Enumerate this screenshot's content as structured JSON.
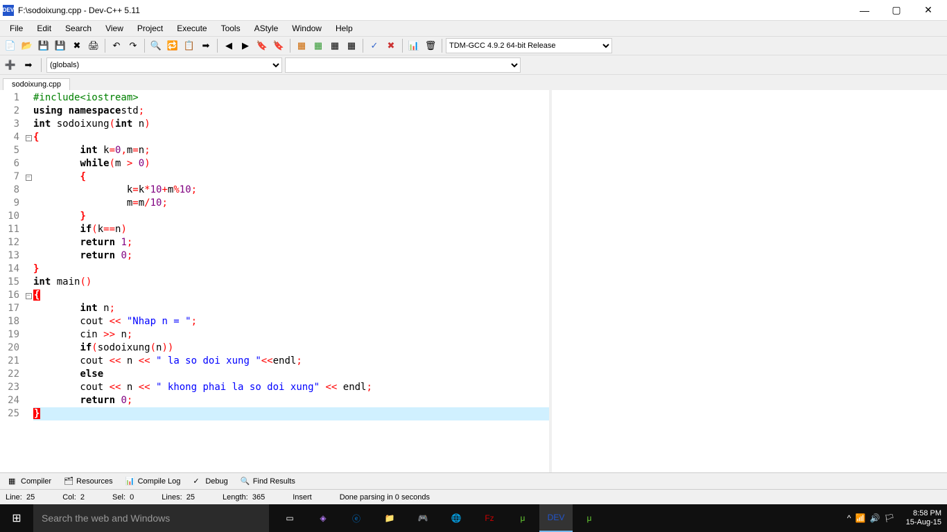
{
  "window": {
    "title": "F:\\sodoixung.cpp - Dev-C++ 5.11",
    "appicon": "DEV"
  },
  "menu": {
    "file": "File",
    "edit": "Edit",
    "search": "Search",
    "view": "View",
    "project": "Project",
    "execute": "Execute",
    "tools": "Tools",
    "astyle": "AStyle",
    "window": "Window",
    "help": "Help"
  },
  "toolbar": {
    "compiler_select": "TDM-GCC 4.9.2 64-bit Release"
  },
  "toolbar2": {
    "globals_select": "(globals)",
    "class_select": ""
  },
  "tabs": {
    "active": "sodoixung.cpp"
  },
  "code": {
    "lines": [
      {
        "n": 1,
        "fold": "",
        "tokens": [
          [
            "pre",
            "#include<iostream>"
          ]
        ]
      },
      {
        "n": 2,
        "fold": "",
        "tokens": [
          [
            "kw",
            "using namespace"
          ],
          [
            "",
            ""
          ],
          [
            "",
            "std"
          ],
          [
            "op",
            ";"
          ]
        ]
      },
      {
        "n": 3,
        "fold": "",
        "tokens": [
          [
            "kw",
            "int"
          ],
          [
            "",
            " sodoixung"
          ],
          [
            "op",
            "("
          ],
          [
            "kw",
            "int"
          ],
          [
            "",
            " n"
          ],
          [
            "op",
            ")"
          ]
        ]
      },
      {
        "n": 4,
        "fold": "box",
        "tokens": [
          [
            "br",
            "{"
          ]
        ]
      },
      {
        "n": 5,
        "fold": "",
        "tokens": [
          [
            "",
            "        "
          ],
          [
            "kw",
            "int"
          ],
          [
            "",
            " k"
          ],
          [
            "op",
            "="
          ],
          [
            "num",
            "0"
          ],
          [
            "op",
            ","
          ],
          [
            "",
            "m"
          ],
          [
            "op",
            "="
          ],
          [
            "",
            "n"
          ],
          [
            "op",
            ";"
          ]
        ]
      },
      {
        "n": 6,
        "fold": "",
        "tokens": [
          [
            "",
            "        "
          ],
          [
            "kw",
            "while"
          ],
          [
            "op",
            "("
          ],
          [
            "",
            "m "
          ],
          [
            "op",
            ">"
          ],
          [
            "",
            " "
          ],
          [
            "num",
            "0"
          ],
          [
            "op",
            ")"
          ]
        ]
      },
      {
        "n": 7,
        "fold": "box",
        "tokens": [
          [
            "",
            "        "
          ],
          [
            "br",
            "{"
          ]
        ]
      },
      {
        "n": 8,
        "fold": "",
        "tokens": [
          [
            "",
            "                k"
          ],
          [
            "op",
            "="
          ],
          [
            "",
            "k"
          ],
          [
            "op",
            "*"
          ],
          [
            "num",
            "10"
          ],
          [
            "op",
            "+"
          ],
          [
            "",
            "m"
          ],
          [
            "op",
            "%"
          ],
          [
            "num",
            "10"
          ],
          [
            "op",
            ";"
          ]
        ]
      },
      {
        "n": 9,
        "fold": "",
        "tokens": [
          [
            "",
            "                m"
          ],
          [
            "op",
            "="
          ],
          [
            "",
            "m"
          ],
          [
            "op",
            "/"
          ],
          [
            "num",
            "10"
          ],
          [
            "op",
            ";"
          ]
        ]
      },
      {
        "n": 10,
        "fold": "",
        "tokens": [
          [
            "",
            "        "
          ],
          [
            "br",
            "}"
          ]
        ]
      },
      {
        "n": 11,
        "fold": "",
        "tokens": [
          [
            "",
            "        "
          ],
          [
            "kw",
            "if"
          ],
          [
            "op",
            "("
          ],
          [
            "",
            "k"
          ],
          [
            "op",
            "=="
          ],
          [
            "",
            "n"
          ],
          [
            "op",
            ")"
          ]
        ]
      },
      {
        "n": 12,
        "fold": "",
        "tokens": [
          [
            "",
            "        "
          ],
          [
            "kw",
            "return"
          ],
          [
            "",
            " "
          ],
          [
            "num",
            "1"
          ],
          [
            "op",
            ";"
          ]
        ]
      },
      {
        "n": 13,
        "fold": "",
        "tokens": [
          [
            "",
            "        "
          ],
          [
            "kw",
            "return"
          ],
          [
            "",
            " "
          ],
          [
            "num",
            "0"
          ],
          [
            "op",
            ";"
          ]
        ]
      },
      {
        "n": 14,
        "fold": "",
        "tokens": [
          [
            "br",
            "}"
          ]
        ]
      },
      {
        "n": 15,
        "fold": "",
        "tokens": [
          [
            "kw",
            "int"
          ],
          [
            "",
            " main"
          ],
          [
            "op",
            "()"
          ]
        ]
      },
      {
        "n": 16,
        "fold": "box",
        "tokens": [
          [
            "brhl",
            "{"
          ]
        ]
      },
      {
        "n": 17,
        "fold": "",
        "tokens": [
          [
            "",
            "        "
          ],
          [
            "kw",
            "int"
          ],
          [
            "",
            " n"
          ],
          [
            "op",
            ";"
          ]
        ]
      },
      {
        "n": 18,
        "fold": "",
        "tokens": [
          [
            "",
            "        cout "
          ],
          [
            "op",
            "<<"
          ],
          [
            "",
            " "
          ],
          [
            "str",
            "\"Nhap n = \""
          ],
          [
            "op",
            ";"
          ]
        ]
      },
      {
        "n": 19,
        "fold": "",
        "tokens": [
          [
            "",
            "        cin "
          ],
          [
            "op",
            ">>"
          ],
          [
            "",
            " n"
          ],
          [
            "op",
            ";"
          ]
        ]
      },
      {
        "n": 20,
        "fold": "",
        "tokens": [
          [
            "",
            "        "
          ],
          [
            "kw",
            "if"
          ],
          [
            "op",
            "("
          ],
          [
            "",
            "sodoixung"
          ],
          [
            "op",
            "("
          ],
          [
            "",
            "n"
          ],
          [
            "op",
            "))"
          ]
        ]
      },
      {
        "n": 21,
        "fold": "",
        "tokens": [
          [
            "",
            "        cout "
          ],
          [
            "op",
            "<<"
          ],
          [
            "",
            " n "
          ],
          [
            "op",
            "<<"
          ],
          [
            "",
            " "
          ],
          [
            "str",
            "\" la so doi xung \""
          ],
          [
            "op",
            "<<"
          ],
          [
            "",
            "endl"
          ],
          [
            "op",
            ";"
          ]
        ]
      },
      {
        "n": 22,
        "fold": "",
        "tokens": [
          [
            "",
            "        "
          ],
          [
            "kw",
            "else"
          ]
        ]
      },
      {
        "n": 23,
        "fold": "",
        "tokens": [
          [
            "",
            "        cout "
          ],
          [
            "op",
            "<<"
          ],
          [
            "",
            " n "
          ],
          [
            "op",
            "<<"
          ],
          [
            "",
            " "
          ],
          [
            "str",
            "\" khong phai la so doi xung\""
          ],
          [
            "",
            " "
          ],
          [
            "op",
            "<<"
          ],
          [
            "",
            " endl"
          ],
          [
            "op",
            ";"
          ]
        ]
      },
      {
        "n": 24,
        "fold": "",
        "tokens": [
          [
            "",
            "        "
          ],
          [
            "kw",
            "return"
          ],
          [
            "",
            " "
          ],
          [
            "num",
            "0"
          ],
          [
            "op",
            ";"
          ]
        ]
      },
      {
        "n": 25,
        "fold": "",
        "hl": true,
        "tokens": [
          [
            "brhl",
            "}"
          ]
        ]
      }
    ]
  },
  "bottomtabs": {
    "compiler": "Compiler",
    "resources": "Resources",
    "compilelog": "Compile Log",
    "debug": "Debug",
    "findresults": "Find Results"
  },
  "status": {
    "line_l": "Line:",
    "line_v": "25",
    "col_l": "Col:",
    "col_v": "2",
    "sel_l": "Sel:",
    "sel_v": "0",
    "lines_l": "Lines:",
    "lines_v": "25",
    "len_l": "Length:",
    "len_v": "365",
    "mode": "Insert",
    "msg": "Done parsing in 0 seconds"
  },
  "taskbar": {
    "search_placeholder": "Search the web and Windows",
    "time": "8:58 PM",
    "date": "15-Aug-15"
  }
}
